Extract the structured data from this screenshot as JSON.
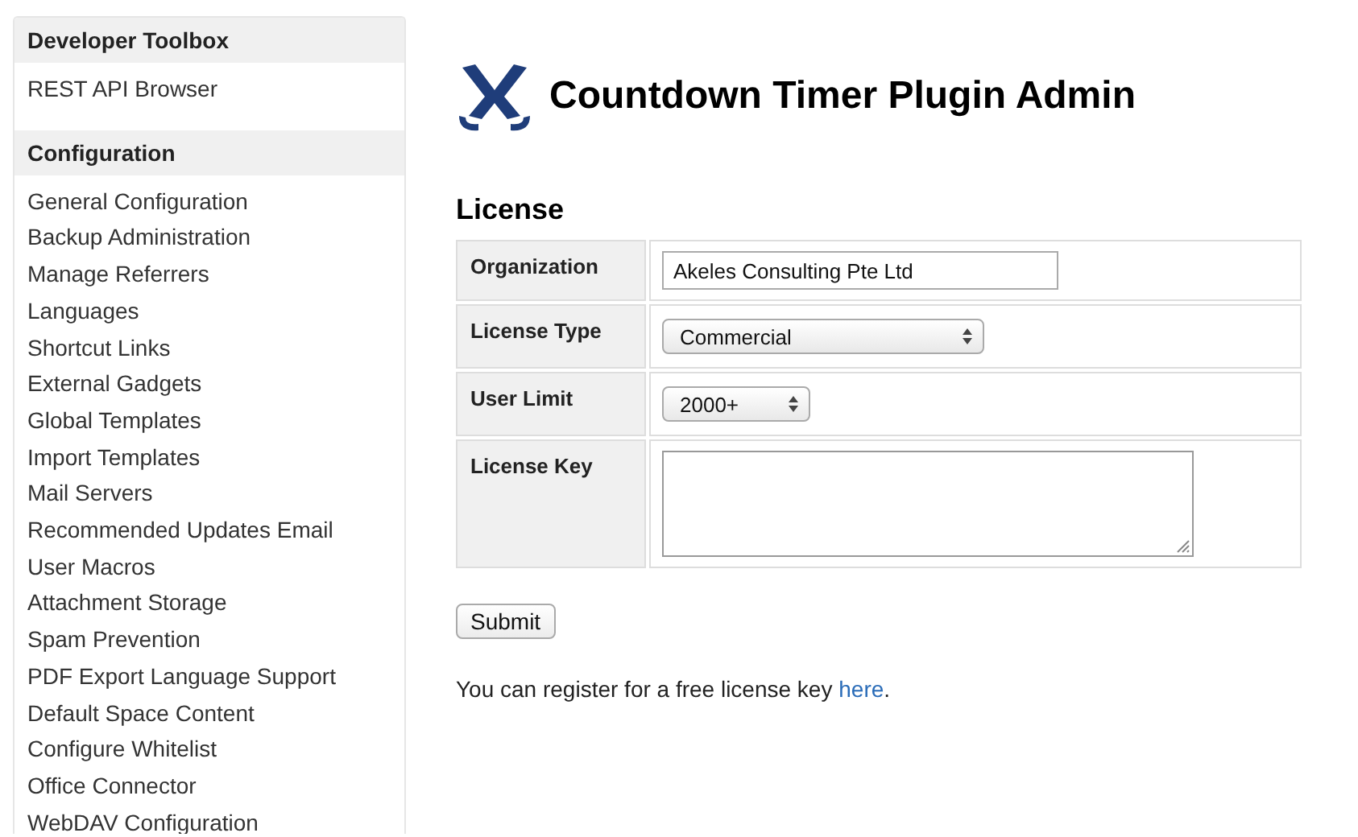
{
  "sidebar": {
    "sections": [
      {
        "title": "Developer Toolbox",
        "items": [
          "REST API Browser"
        ]
      },
      {
        "title": "Configuration",
        "items": [
          "General Configuration",
          "Backup Administration",
          "Manage Referrers",
          "Languages",
          "Shortcut Links",
          "External Gadgets",
          "Global Templates",
          "Import Templates",
          "Mail Servers",
          "Recommended Updates Email",
          "User Macros",
          "Attachment Storage",
          "Spam Prevention",
          "PDF Export Language Support",
          "Default Space Content",
          "Configure Whitelist",
          "Office Connector",
          "WebDAV Configuration"
        ]
      }
    ]
  },
  "page": {
    "title": "Countdown Timer Plugin Admin",
    "section_title": "License",
    "fields": [
      {
        "kind": "text",
        "label": "Organization",
        "value": "Akeles Consulting Pte Ltd"
      },
      {
        "kind": "select",
        "label": "License Type",
        "value": "Commercial"
      },
      {
        "kind": "select",
        "label": "User Limit",
        "value": "2000+"
      },
      {
        "kind": "textarea",
        "label": "License Key"
      }
    ],
    "submit": "Submit",
    "note": {
      "before": "You can register for a free license key ",
      "link": "here",
      "after": "."
    }
  }
}
